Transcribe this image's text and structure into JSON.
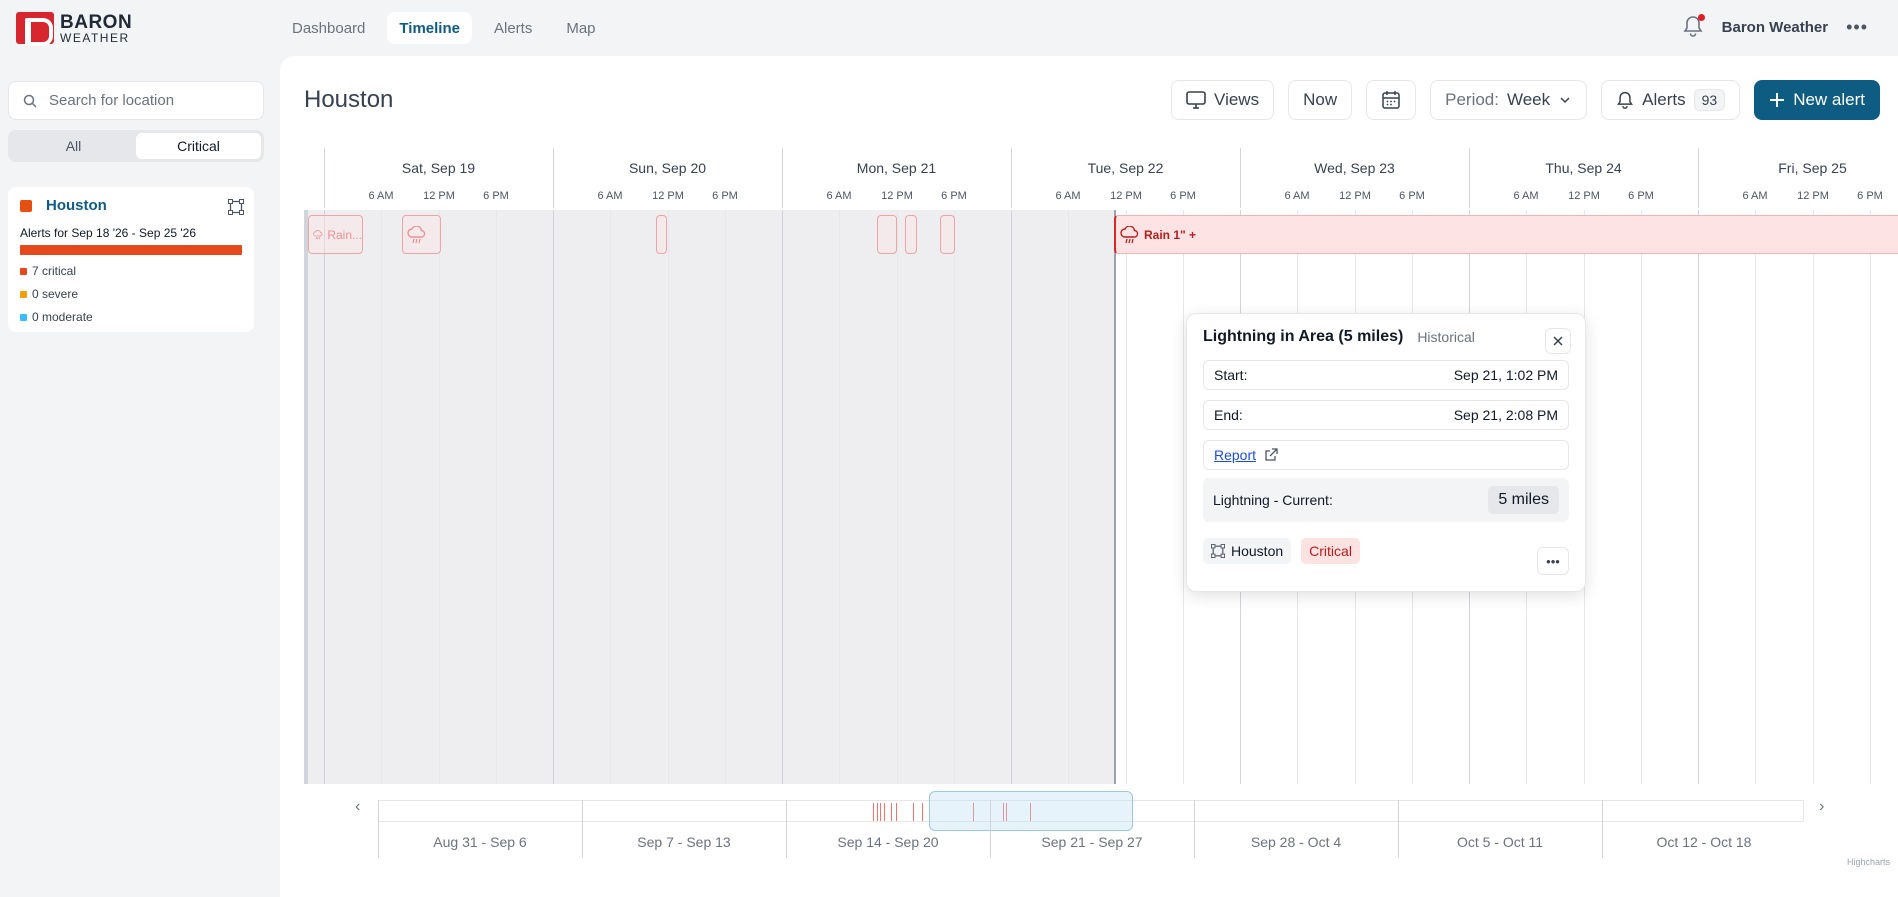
{
  "brand": {
    "line1": "BARON",
    "line2": "WEATHER"
  },
  "nav": [
    "Dashboard",
    "Timeline",
    "Alerts",
    "Map"
  ],
  "user": {
    "name": "Baron Weather",
    "more": "•••"
  },
  "search": {
    "placeholder": "Search for location"
  },
  "filter": {
    "all": "All",
    "critical": "Critical"
  },
  "location_card": {
    "name": "Houston",
    "subtitle": "Alerts for Sep 18 '26 - Sep 25 '26",
    "critical": "7 critical",
    "severe": "0 severe",
    "moderate": "0 moderate",
    "colors": {
      "critical": "#e5481a",
      "severe": "#f59e0b",
      "moderate": "#38bdf8"
    }
  },
  "page": {
    "title": "Houston"
  },
  "toolbar": {
    "views": "Views",
    "now": "Now",
    "period_label": "Period:",
    "period_value": "Week",
    "alerts": "Alerts",
    "alerts_count": "93",
    "new_alert": "New alert"
  },
  "timeline": {
    "days": [
      "Sat, Sep 19",
      "Sun, Sep 20",
      "Mon, Sep 21",
      "Tue, Sep 22",
      "Wed, Sep 23",
      "Thu, Sep 24",
      "Fri, Sep 25"
    ],
    "hours": [
      "6 AM",
      "12 PM",
      "6 PM"
    ],
    "blocks": [
      {
        "label": "Rain..."
      },
      {
        "label": ""
      },
      {
        "label": ""
      },
      {
        "label": ""
      },
      {
        "label": ""
      },
      {
        "label": ""
      },
      {
        "label": "Rain 1\" +"
      }
    ]
  },
  "popup": {
    "title": "Lightning in Area (5 miles)",
    "status": "Historical",
    "start_label": "Start:",
    "start_value": "Sep 21, 1:02 PM",
    "end_label": "End:",
    "end_value": "Sep 21, 2:08 PM",
    "report": "Report",
    "metric_label": "Lightning - Current:",
    "metric_value": "5 miles",
    "location": "Houston",
    "severity": "Critical"
  },
  "navigator": {
    "weeks": [
      "Aug 31 - Sep 6",
      "Sep 7 - Sep 13",
      "Sep 14 - Sep 20",
      "Sep 21 - Sep 27",
      "Sep 28 - Oct 4",
      "Oct 5 - Oct 11",
      "Oct 12 - Oct 18"
    ]
  },
  "credits": "Highcharts"
}
